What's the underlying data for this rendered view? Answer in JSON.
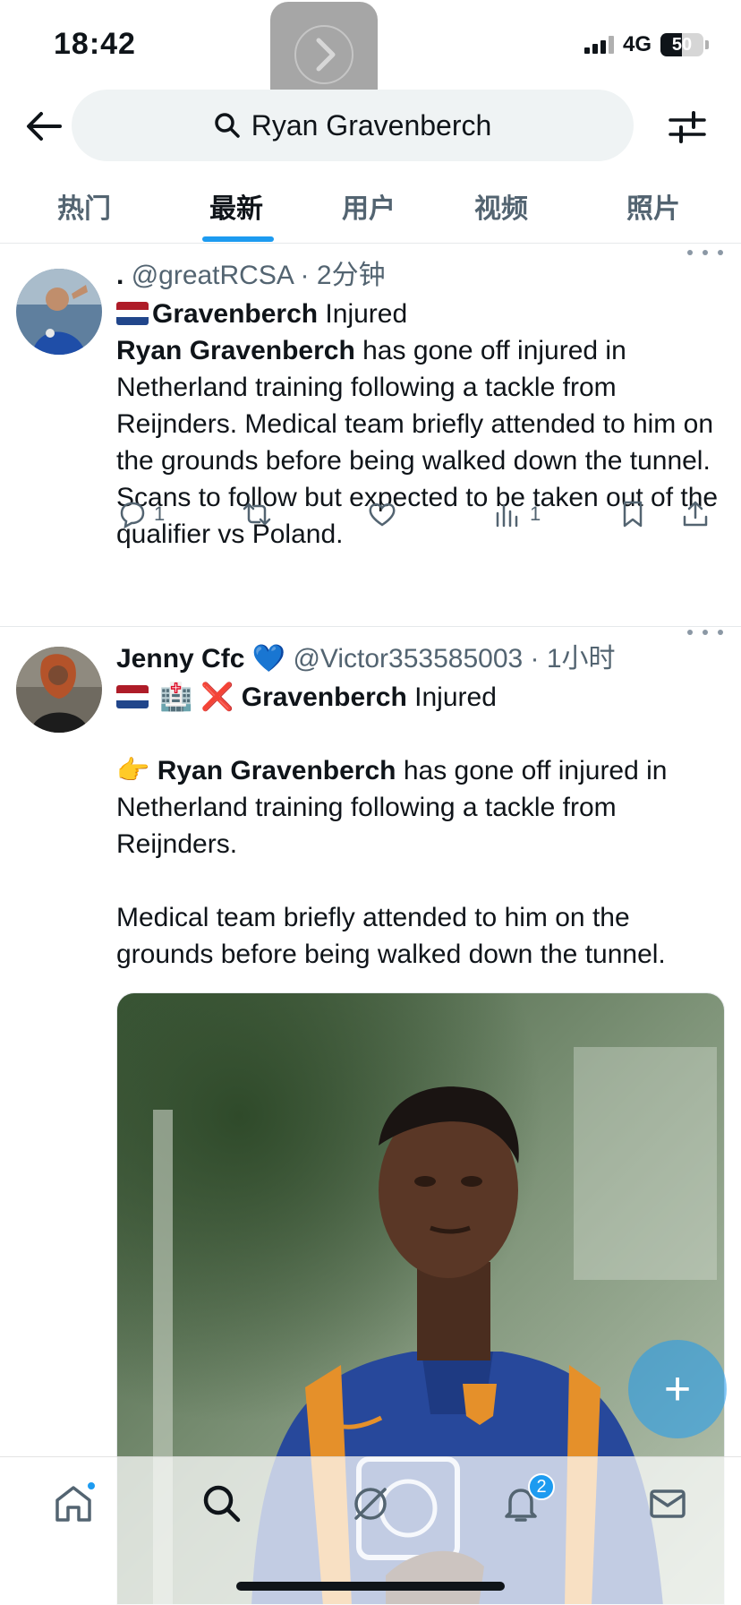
{
  "status_bar": {
    "time": "18:42",
    "network": "4G",
    "battery": "50",
    "battery_level": 0.5
  },
  "header": {
    "search_query": "Ryan Gravenberch"
  },
  "tabs": [
    {
      "label": "热门",
      "active": false
    },
    {
      "label": "最新",
      "active": true
    },
    {
      "label": "用户",
      "active": false
    },
    {
      "label": "视频",
      "active": false
    },
    {
      "label": "照片",
      "active": false
    }
  ],
  "tweets": [
    {
      "display_name": ".",
      "handle": "@greatRCSA",
      "time": "2分钟",
      "lines": {
        "headline_bold": "Gravenberch",
        "headline_rest": " Injured",
        "body_bold": "Ryan Gravenberch",
        "body_rest": " has gone off injured in Netherland training following a tackle from Reijnders. Medical team briefly attended to him on the grounds before being walked down the tunnel. Scans to follow but expected to be taken out of the qualifier vs Poland."
      },
      "actions": {
        "replies": "1",
        "retweets": "",
        "likes": "",
        "views": "1"
      }
    },
    {
      "display_name": "Jenny Cfc",
      "name_emoji": "💙",
      "handle": "@Victor353585003",
      "time": "1小时",
      "lines": {
        "emojis": "🏥 ❌",
        "headline_bold": "Gravenberch",
        "headline_rest": " Injured",
        "para1_prefix": "👉",
        "para1_bold": "Ryan Gravenberch",
        "para1_rest": " has gone off injured in Netherland training following a tackle from Reijnders.",
        "para2": "Medical team briefly attended to him on the grounds before being walked down the tunnel."
      }
    }
  ],
  "bottom_nav": {
    "notifications_count": "2"
  },
  "colors": {
    "accent": "#1d9bf0",
    "text": "#0f1419",
    "muted": "#536471",
    "pill": "#eff3f4"
  }
}
